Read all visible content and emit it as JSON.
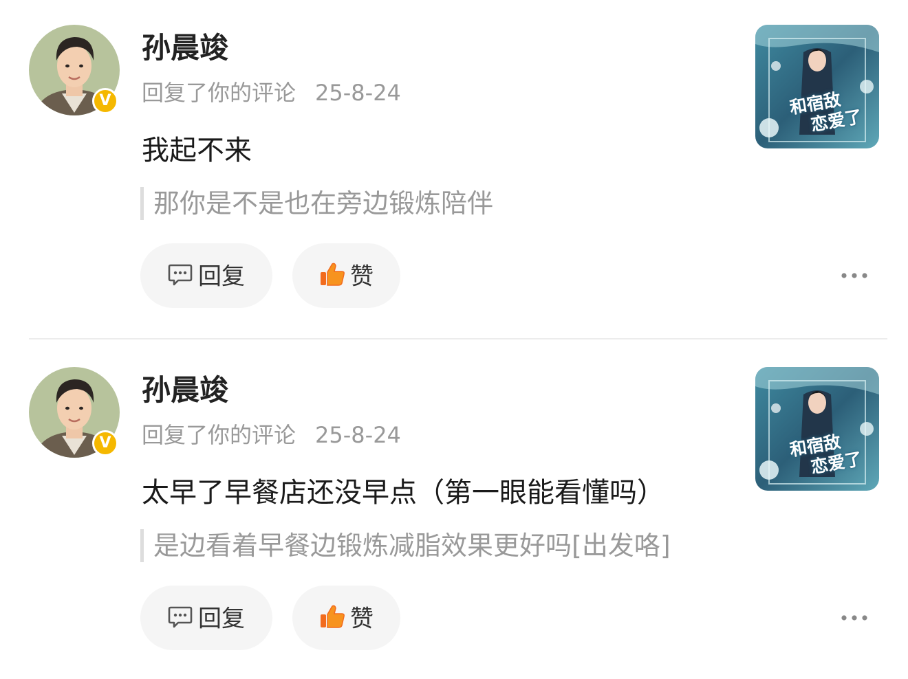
{
  "colors": {
    "name_text": "#222222",
    "meta_text": "#999999",
    "quote_bar": "#dddddd",
    "button_bg": "#f5f5f5",
    "like_icon": "#f26b1d",
    "verified_badge": "#f5b800"
  },
  "actions": {
    "reply_label": "回复",
    "like_label": "赞",
    "reply_icon": "comment-bubble-icon",
    "like_icon": "thumbs-up-icon",
    "more_icon": "more-dots-icon"
  },
  "comments": [
    {
      "username": "孙晨竣",
      "badge": "V",
      "action_text": "回复了你的评论",
      "date": "25-8-24",
      "content": "我起不来",
      "quoted_comment": "那你是不是也在旁边锻炼陪伴",
      "thumbnail_title": [
        "和宿敌",
        "恋爱了"
      ]
    },
    {
      "username": "孙晨竣",
      "badge": "V",
      "action_text": "回复了你的评论",
      "date": "25-8-24",
      "content": "太早了早餐店还没早点（第一眼能看懂吗）",
      "quoted_comment": "是边看着早餐边锻炼减脂效果更好吗[出发咯]",
      "thumbnail_title": [
        "和宿敌",
        "恋爱了"
      ]
    }
  ]
}
